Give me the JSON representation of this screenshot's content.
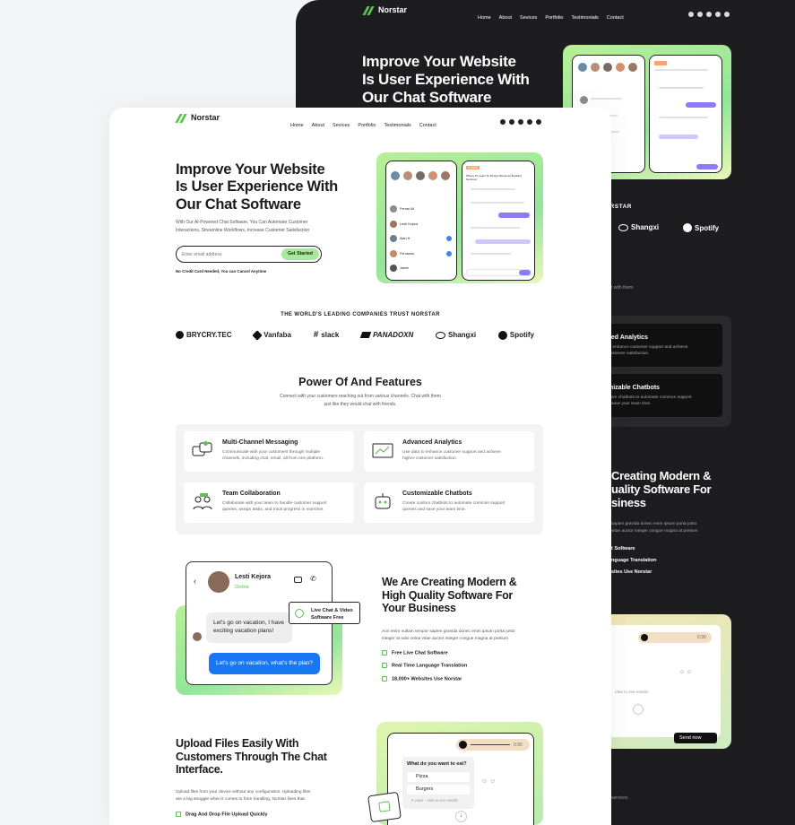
{
  "brand": {
    "name": "Norstar"
  },
  "nav": {
    "items": [
      "Home",
      "About",
      "Sevices",
      "Portfolio",
      "Testimonials",
      "Contact"
    ]
  },
  "hero": {
    "title_line1": "Improve Your Website",
    "title_line2": "Is User Experience With",
    "title_line3": "Our Chat Software",
    "subtitle_line1": "With Our AI-Powered Chat Software, You Can Automate Customer",
    "subtitle_line2": "Interactions, Streamline Workflows, Increase Customer Satisfaction",
    "email_placeholder": "Enter email address",
    "cta": "Get Started",
    "note": "No Credit Card Needed, You can Cancel Anytime"
  },
  "mock_app": {
    "contacts": [
      "Ferrari Ali",
      "Lesti Kejora",
      "Alan H.",
      "Fernando",
      "Jamie"
    ],
    "badge": "#TASK",
    "title": "Where To Learn To Design Business Booking Services"
  },
  "trust": {
    "heading": "THE WORLD'S LEADING COMPANIES TRUST NORSTAR",
    "logos": [
      "BRYCRY.TEC",
      "Vanfaba",
      "slack",
      "PANADOXN",
      "Shangxi",
      "Spotify"
    ]
  },
  "features": {
    "title": "Power Of And Features",
    "subtitle_line1": "Connect with your customers reaching out from various channels. Chat with them",
    "subtitle_line2": "just like they would chat with friends.",
    "items": [
      {
        "title": "Multi-Channel Messaging",
        "desc_line1": "Communicate with your customers through multiple",
        "desc_line2": "channels, including chat, email, all from one platform."
      },
      {
        "title": "Advanced Analytics",
        "desc_line1": "Use data to enhance customer support and achieve",
        "desc_line2": "higher customer satisfaction."
      },
      {
        "title": "Team Collaboration",
        "desc_line1": "Collaborate with your team to handle customer support",
        "desc_line2": "queries, assign tasks, and track progress in real-time."
      },
      {
        "title": "Customizable Chatbots",
        "desc_line1": "Create custom chatbots to automate common support",
        "desc_line2": "queries and save your team time."
      }
    ]
  },
  "chat_demo": {
    "name": "Lesti Kejora",
    "status": "Online",
    "msg_in_line1": "Let's go on vacation, I have",
    "msg_in_line2": "exciting vacation plans!",
    "msg_out": "Let's go on vacation, what's the plan?",
    "tag_line1": "Live Chat & Video",
    "tag_line2": "Software Free"
  },
  "quality": {
    "title_line1": "We Are Creating Modern &",
    "title_line2": "High Quality Software For",
    "title_line3": "Your Business",
    "desc_line1": "Aon enim nullam tempor sapien gravida donec enim ipsum porta justo",
    "desc_line2": "integer at odio velna vitae auctor integer congue magna at pretium",
    "bullets": [
      "Free Live Chat Software",
      "Real Time Language Translation",
      "18,000+ Websites Use Norstar"
    ]
  },
  "upload": {
    "title_line1": "Upload Files Easily With",
    "title_line2": "Customers Through The Chat",
    "title_line3": "Interface.",
    "desc_line1": "Upload files from your device without any configuration. Uploading files",
    "desc_line2": "are a big struggle when it comes to form handling, Norstar fixes that.",
    "bullet": "Drag And Drop File Upload Quickly",
    "poll_question": "What do you want to eat?",
    "options": [
      "Pizza",
      "Burgers"
    ],
    "votes": "0 votes · Vote to see results",
    "audio_time": "0:30"
  },
  "dark": {
    "trust_fragment": "ORSTAR",
    "logos": [
      "Shangxi",
      "Spotify"
    ],
    "sub_fragment": "t with them",
    "f1_title": "ced Analytics",
    "f1_l1": "to enhance customer support and achieve",
    "f1_l2": "customer satisfaction.",
    "f2_title": "mizable Chatbots",
    "f2_l1": "stom chatbots to automate common support",
    "f2_l2": "d save your team time.",
    "q_l1": "Creating Modern &",
    "q_l2": "uality Software For",
    "q_l3": "siness",
    "q_d1": "sapien gravida donec enim ipsum porta justo",
    "q_d2": "vitae auctor integer congue magna at pretium",
    "b1": "t Software",
    "b2": "nguage Translation",
    "b3": "sites Use Norstar",
    "poll_q": "you want to eat?",
    "opt2": "ers",
    "votes": "Vote to see results",
    "send": "Send now",
    "time": "0:30",
    "bottom": "services."
  },
  "colors": {
    "accent": "#5bc44e",
    "purple": "#8b7cf6",
    "blue": "#1877f2",
    "dark_bg": "#1d1d1f"
  }
}
